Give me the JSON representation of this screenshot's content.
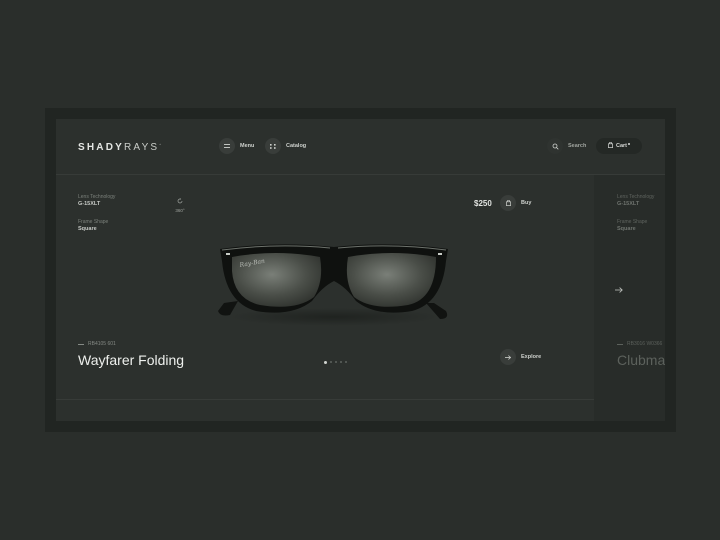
{
  "brand": {
    "bold": "SHADY",
    "light": "RAYS"
  },
  "header": {
    "menu_label": "Menu",
    "catalog_label": "Catalog",
    "search_label": "Search",
    "cart_label": "Cart"
  },
  "product": {
    "specs": [
      {
        "label": "Lens Technology",
        "value": "G-15XLT"
      },
      {
        "label": "Frame Shape",
        "value": "Square"
      }
    ],
    "rotate_label": "360°",
    "price": "$250",
    "buy_label": "Buy",
    "model": "RB4105 601",
    "title": "Wayfarer Folding",
    "explore_label": "Explore"
  },
  "next_product": {
    "specs": [
      {
        "label": "Lens Technology",
        "value": "G-15XLT"
      },
      {
        "label": "Frame Shape",
        "value": "Square"
      }
    ],
    "model": "RB3016 W0366",
    "title": "Clubmaster"
  },
  "carousel": {
    "count": 5,
    "active": 1
  },
  "colors": {
    "background": "#2a2e2b",
    "screen": "#2c302d",
    "text": "#eef0ed"
  }
}
